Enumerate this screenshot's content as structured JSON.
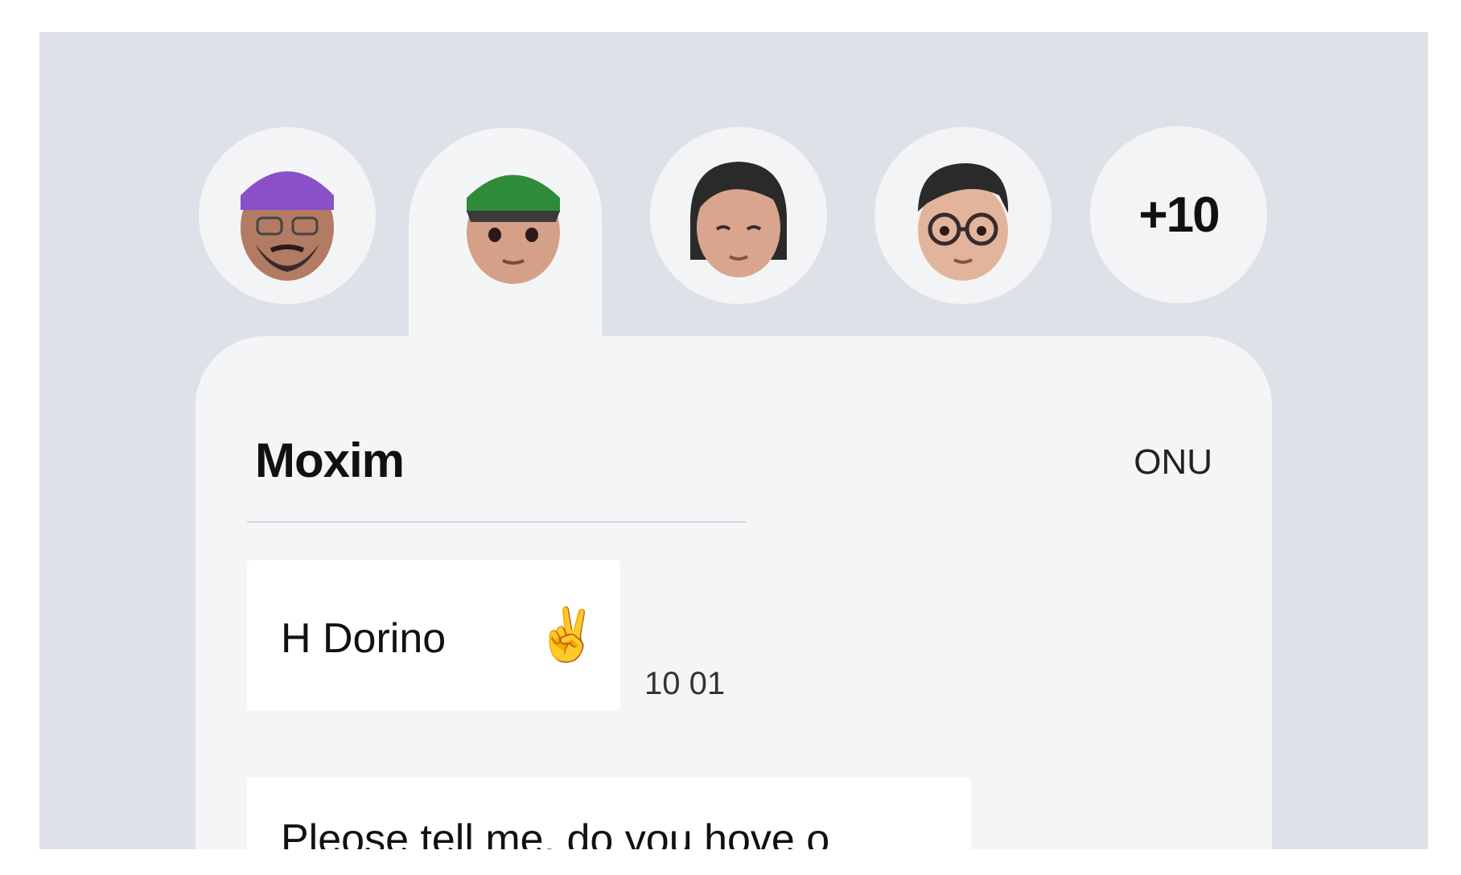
{
  "avatars": [
    {
      "label": "avatar-purple-beanie",
      "hat_color": "#8a50c8"
    },
    {
      "label": "avatar-green-cap",
      "hat_color": "#2e8b3a"
    },
    {
      "label": "avatar-dark-hair",
      "hat_color": "#2a2a2a"
    },
    {
      "label": "avatar-glasses",
      "hat_color": "#2a2a2a"
    }
  ],
  "more_count": "+10",
  "chat": {
    "name": "Moxim",
    "status": "ONU",
    "messages": [
      {
        "text": "H Dorino",
        "emoji": "✌️",
        "time": "10 01"
      },
      {
        "text": "Pleose tell me. do you hove o"
      }
    ]
  },
  "colors": {
    "background": "#dfe1e8",
    "card": "#f4f5f7",
    "bubble": "#ffffff",
    "text": "#111111"
  }
}
